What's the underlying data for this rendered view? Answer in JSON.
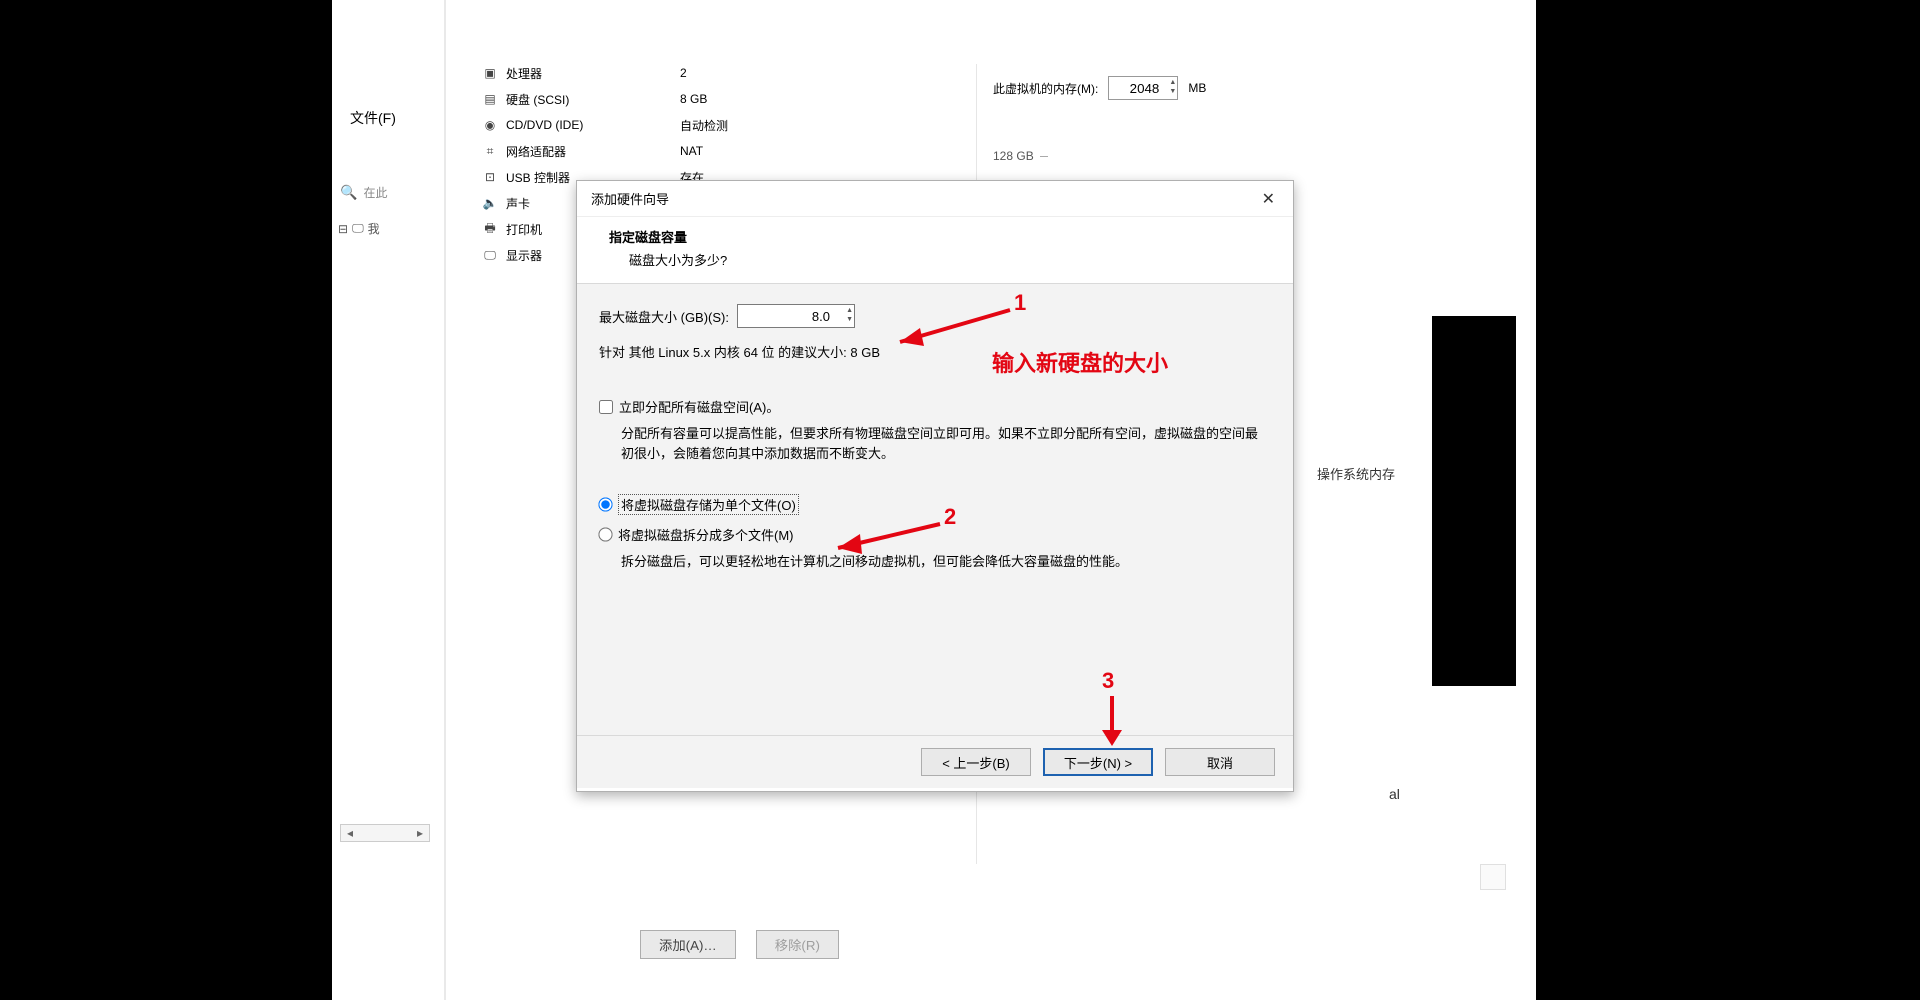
{
  "left": {
    "menu_file": "文件(F)",
    "search_placeholder": "在此",
    "tree_label": "我"
  },
  "hw": {
    "items": [
      {
        "icon": "▣",
        "name": "处理器",
        "value": "2"
      },
      {
        "icon": "▤",
        "name": "硬盘 (SCSI)",
        "value": "8 GB"
      },
      {
        "icon": "◉",
        "name": "CD/DVD (IDE)",
        "value": "自动检测"
      },
      {
        "icon": "⌗",
        "name": "网络适配器",
        "value": "NAT"
      },
      {
        "icon": "⊡",
        "name": "USB 控制器",
        "value": "存在"
      },
      {
        "icon": "🔈",
        "name": "声卡",
        "value": ""
      },
      {
        "icon": "🖶",
        "name": "打印机",
        "value": ""
      },
      {
        "icon": "🖵",
        "name": "显示器",
        "value": ""
      }
    ]
  },
  "right": {
    "mem_label": "此虚拟机的内存(M):",
    "mem_value": "2048",
    "mem_unit": "MB",
    "scale_128": "128 GB",
    "os_hint": "操作系统内存",
    "al": "al"
  },
  "bottom": {
    "add": "添加(A)…",
    "remove": "移除(R)"
  },
  "wizard": {
    "title": "添加硬件向导",
    "heading": "指定磁盘容量",
    "subheading": "磁盘大小为多少?",
    "size_label": "最大磁盘大小 (GB)(S):",
    "size_value": "8.0",
    "recommend": "针对 其他 Linux 5.x 内核 64 位 的建议大小: 8 GB",
    "chk_label": "立即分配所有磁盘空间(A)。",
    "chk_desc": "分配所有容量可以提高性能，但要求所有物理磁盘空间立即可用。如果不立即分配所有空间，虚拟磁盘的空间最初很小，会随着您向其中添加数据而不断变大。",
    "radio1": "将虚拟磁盘存储为单个文件(O)",
    "radio2": "将虚拟磁盘拆分成多个文件(M)",
    "radio_desc": "拆分磁盘后，可以更轻松地在计算机之间移动虚拟机，但可能会降低大容量磁盘的性能。",
    "btn_back": "< 上一步(B)",
    "btn_next": "下一步(N) >",
    "btn_cancel": "取消"
  },
  "annotations": {
    "n1": "1",
    "n2": "2",
    "n3": "3",
    "text1": "输入新硬盘的大小"
  }
}
